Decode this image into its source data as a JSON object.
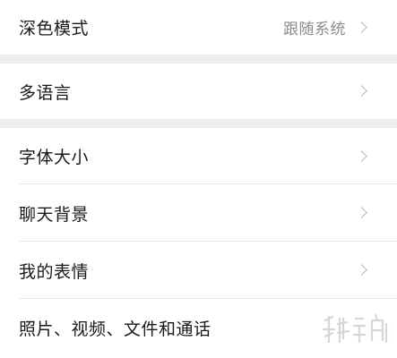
{
  "settings": {
    "dark_mode": {
      "label": "深色模式",
      "value": "跟随系统"
    },
    "language": {
      "label": "多语言"
    },
    "items": [
      {
        "label": "字体大小"
      },
      {
        "label": "聊天背景"
      },
      {
        "label": "我的表情"
      },
      {
        "label": "照片、视频、文件和通话"
      }
    ]
  },
  "icons": {
    "chevron": "chevron-right-icon"
  }
}
